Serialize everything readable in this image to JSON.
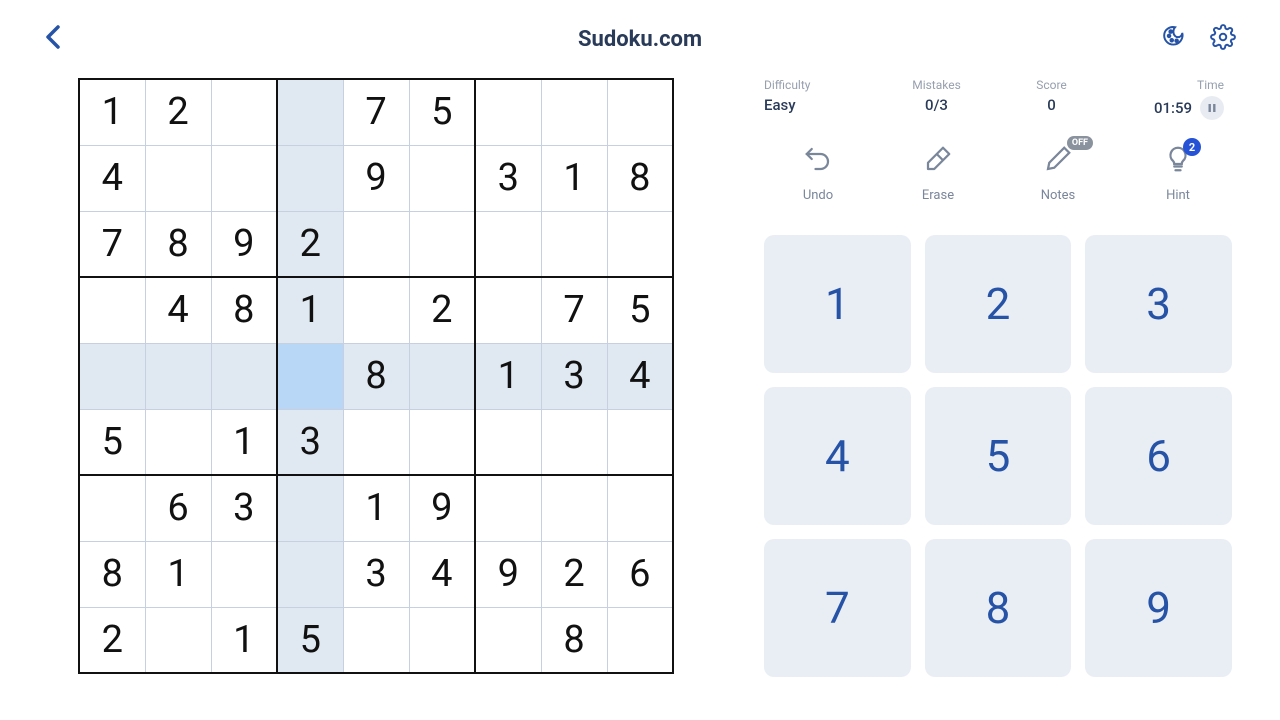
{
  "header": {
    "title": "Sudoku.com"
  },
  "stats": {
    "difficulty_label": "Difficulty",
    "difficulty_value": "Easy",
    "mistakes_label": "Mistakes",
    "mistakes_value": "0/3",
    "score_label": "Score",
    "score_value": "0",
    "time_label": "Time",
    "time_value": "01:59"
  },
  "tools": {
    "undo": "Undo",
    "erase": "Erase",
    "notes": "Notes",
    "notes_badge": "OFF",
    "hint": "Hint",
    "hint_badge": "2"
  },
  "numpad": [
    "1",
    "2",
    "3",
    "4",
    "5",
    "6",
    "7",
    "8",
    "9"
  ],
  "selected": {
    "row": 4,
    "col": 3
  },
  "board": [
    [
      "1",
      "2",
      "",
      "",
      "7",
      "5",
      "",
      "",
      ""
    ],
    [
      "4",
      "",
      "",
      "",
      "9",
      "",
      "3",
      "1",
      "8"
    ],
    [
      "7",
      "8",
      "9",
      "2",
      "",
      "",
      "",
      "",
      ""
    ],
    [
      "",
      "4",
      "8",
      "1",
      "",
      "2",
      "",
      "7",
      "5"
    ],
    [
      "",
      "",
      "",
      "",
      "8",
      "",
      "1",
      "3",
      "4"
    ],
    [
      "5",
      "",
      "1",
      "3",
      "",
      "",
      "",
      "",
      ""
    ],
    [
      "",
      "6",
      "3",
      "",
      "1",
      "9",
      "",
      "",
      ""
    ],
    [
      "8",
      "1",
      "",
      "",
      "3",
      "4",
      "9",
      "2",
      "6"
    ],
    [
      "2",
      "",
      "1",
      "5",
      "",
      "",
      "",
      "8",
      ""
    ]
  ]
}
